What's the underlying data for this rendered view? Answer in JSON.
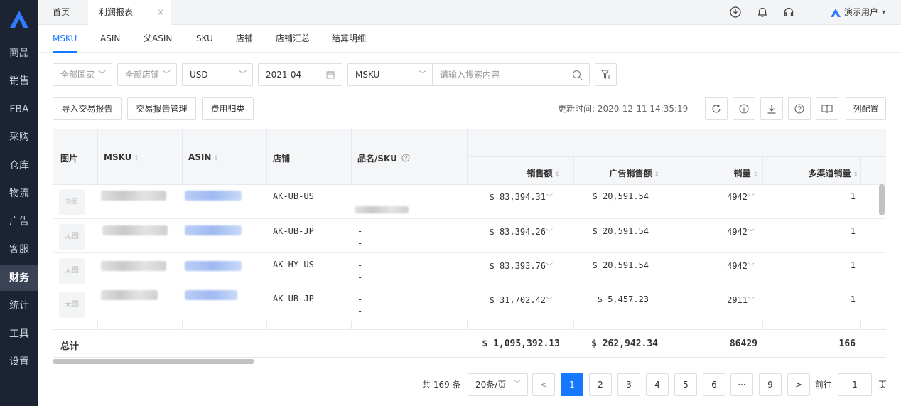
{
  "nav": {
    "items": [
      {
        "label": "商品"
      },
      {
        "label": "销售"
      },
      {
        "label": "FBA"
      },
      {
        "label": "采购"
      },
      {
        "label": "仓库"
      },
      {
        "label": "物流"
      },
      {
        "label": "广告"
      },
      {
        "label": "客服"
      },
      {
        "label": "财务"
      },
      {
        "label": "统计"
      },
      {
        "label": "工具"
      },
      {
        "label": "设置"
      }
    ],
    "active": "财务"
  },
  "topbar": {
    "home_tab": "首页",
    "current_tab": "利润报表",
    "close_glyph": "×",
    "user_name": "演示用户",
    "icons": [
      "download-circle-icon",
      "bell-icon",
      "headset-icon"
    ]
  },
  "subtabs": [
    {
      "label": "MSKU",
      "active": true
    },
    {
      "label": "ASIN"
    },
    {
      "label": "父ASIN"
    },
    {
      "label": "SKU"
    },
    {
      "label": "店铺"
    },
    {
      "label": "店铺汇总"
    },
    {
      "label": "结算明细"
    }
  ],
  "filters": {
    "country": "全部国家",
    "shop": "全部店铺",
    "currency": "USD",
    "month": "2021-04",
    "search_type": "MSKU",
    "search_placeholder": "请输入搜索内容"
  },
  "actions": {
    "import": "导入交易报告",
    "manage": "交易报告管理",
    "fee": "费用归类",
    "update_time": "更新时间: 2020-12-11 14:35:19",
    "column_config": "列配置"
  },
  "table": {
    "headers": {
      "image": "图片",
      "msku": "MSKU",
      "asin": "ASIN",
      "shop": "店铺",
      "name_sku": "品名/SKU",
      "sales": "销售额",
      "ad_sales": "广告销售额",
      "qty": "销量",
      "multi_qty": "多渠道销量"
    },
    "rows": [
      {
        "img": "缺图",
        "shop": "AK-UB-US",
        "name": "",
        "sales": "$ 83,394.31",
        "ad_sales": "$ 20,591.54",
        "qty": "4942",
        "multi_qty": "1"
      },
      {
        "img": "无图",
        "shop": "AK-UB-JP",
        "name": "-",
        "sku": "-",
        "sales": "$ 83,394.26",
        "ad_sales": "$ 20,591.54",
        "qty": "4942",
        "multi_qty": "1"
      },
      {
        "img": "无图",
        "shop": "AK-HY-US",
        "name": "-",
        "sku": "-",
        "sales": "$ 83,393.76",
        "ad_sales": "$ 20,591.54",
        "qty": "4942",
        "multi_qty": "1"
      },
      {
        "img": "无图",
        "shop": "AK-UB-JP",
        "name": "-",
        "sku": "-",
        "sales": "$ 31,702.42",
        "ad_sales": "$ 5,457.23",
        "qty": "2911",
        "multi_qty": "1"
      }
    ],
    "total": {
      "label": "总计",
      "sales": "$ 1,095,392.13",
      "ad_sales": "$ 262,942.34",
      "qty": "86429",
      "multi_qty": "166"
    }
  },
  "pagination": {
    "total": "共 169 条",
    "page_size": "20条/页",
    "pages": [
      "1",
      "2",
      "3",
      "4",
      "5",
      "6",
      "···",
      "9"
    ],
    "current": "1",
    "goto_label": "前往",
    "goto_value": "1",
    "goto_suffix": "页"
  },
  "colors": {
    "accent": "#1677ff",
    "nav_bg": "#1c2333"
  }
}
